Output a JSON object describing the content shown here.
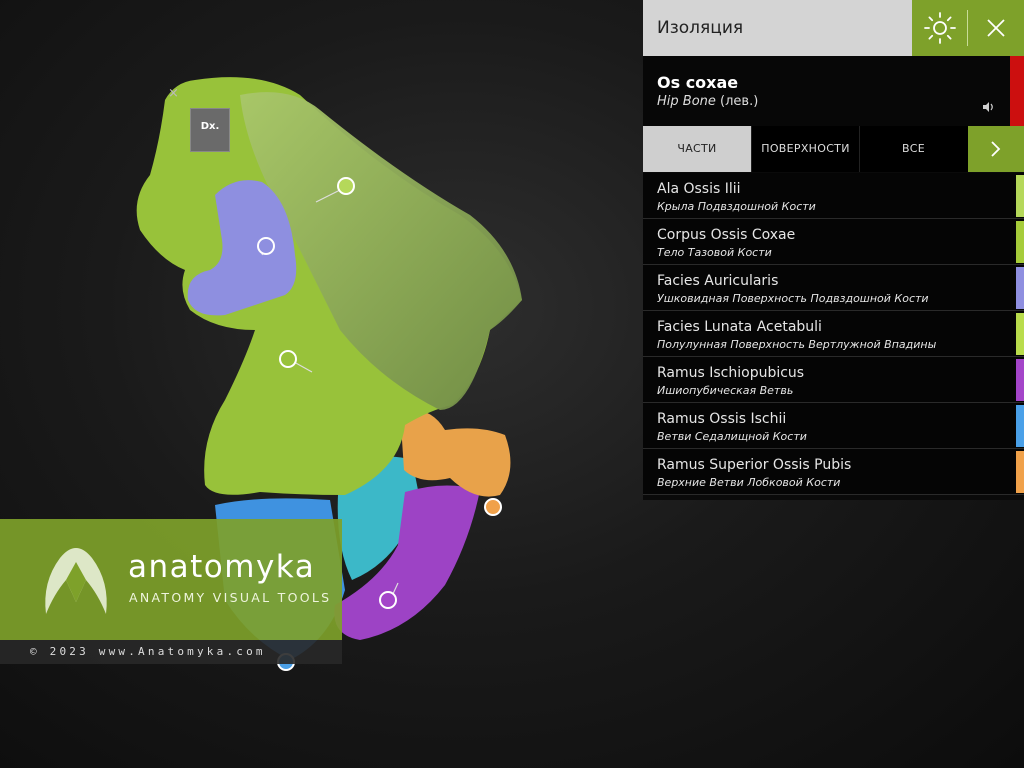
{
  "isolation": {
    "title": "Изоляция",
    "sun_icon": "sun-icon",
    "close_icon": "close-icon"
  },
  "bone": {
    "name": "Os coxae",
    "sub_en": "Hip Bone",
    "sub_side": " (лев.)",
    "sound_icon": "speaker-icon",
    "accent_color": "#cc0f0f"
  },
  "tabs": [
    {
      "label": "ЧАСТИ",
      "active": true
    },
    {
      "label": "ПОВЕРХНОСТИ",
      "active": false
    },
    {
      "label": "ВСЕ",
      "active": false
    }
  ],
  "parts": [
    {
      "en": "Ala Ossis Ilii",
      "ru": "Крыла Подвздошной Кости",
      "color": "#b5d85a"
    },
    {
      "en": "Corpus Ossis Coxae",
      "ru": "Тело Тазовой Кости",
      "color": "#a6cc3a"
    },
    {
      "en": "Facies Auricularis",
      "ru": "Ушковидная Поверхность Подвздошной Кости",
      "color": "#8f8fe0"
    },
    {
      "en": "Facies Lunata Acetabuli",
      "ru": "Полулунная Поверхность Вертлужной Впадины",
      "color": "#b9dc4c"
    },
    {
      "en": "Ramus Ischiopubicus",
      "ru": "Ишиопубическая Ветвь",
      "color": "#a445c9"
    },
    {
      "en": "Ramus Ossis Ischii",
      "ru": "Ветви Седалищной Кости",
      "color": "#4aa0e8"
    },
    {
      "en": "Ramus Superior Ossis Pubis",
      "ru": "Верхние Ветви Лобковой Кости",
      "color": "#f0a14a"
    }
  ],
  "view": {
    "dx_label": "Dx.",
    "close_glyph": "×"
  },
  "brand": {
    "name": "anatomyka",
    "tagline": "ANATOMY VISUAL TOOLS",
    "copyright": "© 2023 www.Anatomyka.com",
    "accent": "#7ea12a"
  }
}
